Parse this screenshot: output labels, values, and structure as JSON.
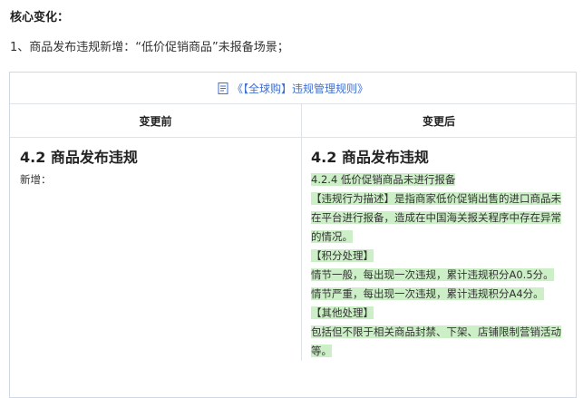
{
  "heading": "核心变化：",
  "intro": "1、商品发布违规新增：“低价促销商品”未报备场景；",
  "table": {
    "title": "《【全球购】违规管理规则》",
    "icon": "document-icon",
    "accent": "#3f6fcf",
    "highlight": "#cdefc7",
    "col_before": "变更前",
    "col_after": "变更后",
    "before": {
      "section": "4.2 商品发布违规",
      "text": "新增："
    },
    "after": {
      "section": "4.2 商品发布违规",
      "lines": [
        "4.2.4 低价促销商品未进行报备",
        "【违规行为描述】是指商家低价促销出售的进口商品未在平台进行报备，造成在中国海关报关程序中存在异常的情况。",
        "【积分处理】",
        "情节一般，每出现一次违规，累计违规积分A0.5分。",
        "情节严重，每出现一次违规，累计违规积分A4分。",
        "【其他处理】",
        "包括但不限于相关商品封禁、下架、店铺限制营销活动等。"
      ]
    }
  }
}
